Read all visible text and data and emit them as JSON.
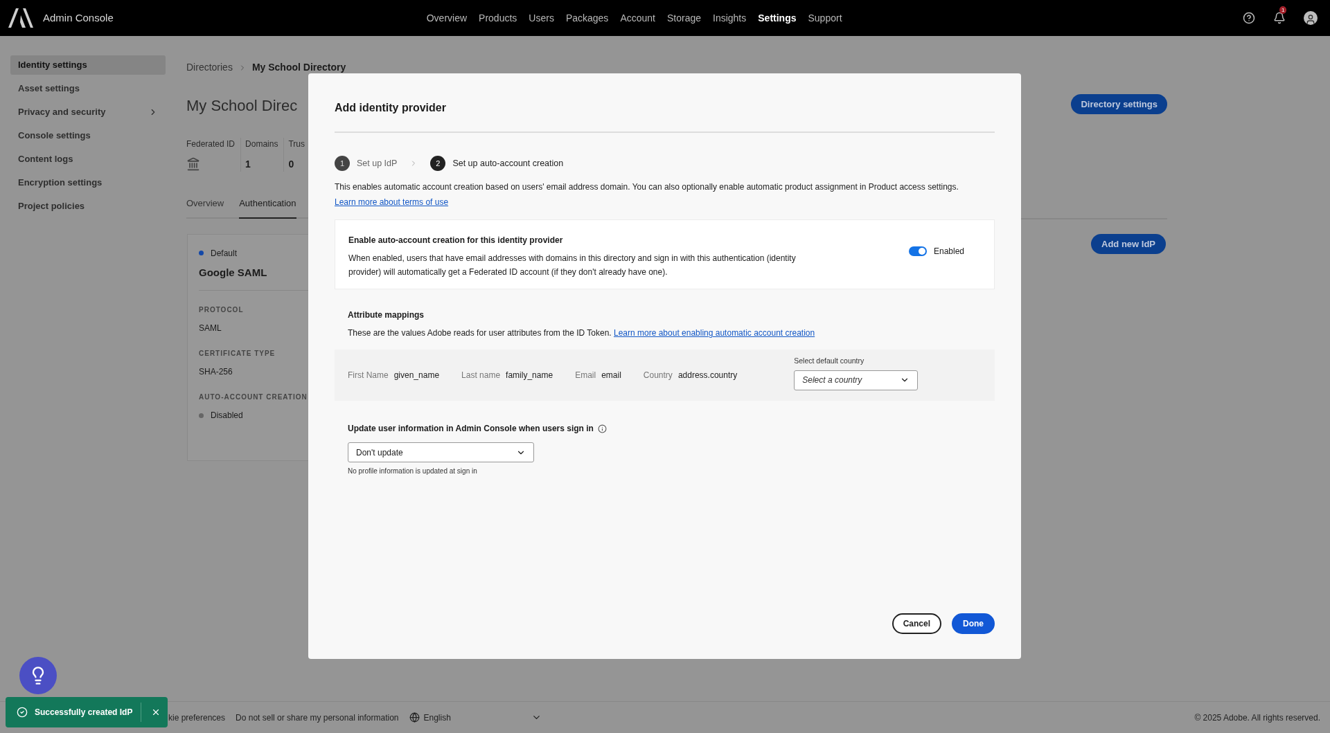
{
  "top_bar": {
    "app_name": "Admin Console",
    "notification_badge": "1",
    "nav": [
      {
        "label": "Overview",
        "selected": false
      },
      {
        "label": "Products",
        "selected": false
      },
      {
        "label": "Users",
        "selected": false
      },
      {
        "label": "Packages",
        "selected": false
      },
      {
        "label": "Account",
        "selected": false
      },
      {
        "label": "Storage",
        "selected": false
      },
      {
        "label": "Insights",
        "selected": false
      },
      {
        "label": "Settings",
        "selected": true
      },
      {
        "label": "Support",
        "selected": false
      }
    ]
  },
  "sidebar": {
    "items": [
      {
        "label": "Identity settings",
        "selected": true,
        "expandable": false
      },
      {
        "label": "Asset settings",
        "selected": false,
        "expandable": false
      },
      {
        "label": "Privacy and security",
        "selected": false,
        "expandable": true
      },
      {
        "label": "Console settings",
        "selected": false,
        "expandable": false
      },
      {
        "label": "Content logs",
        "selected": false,
        "expandable": false
      },
      {
        "label": "Encryption settings",
        "selected": false,
        "expandable": false
      },
      {
        "label": "Project policies",
        "selected": false,
        "expandable": false
      }
    ]
  },
  "breadcrumb": [
    "Directories",
    "My School Directory"
  ],
  "page_title": "My School Direc",
  "stats": [
    {
      "label": "Federated ID",
      "kind": "icon"
    },
    {
      "label": "Domains",
      "kind": "text",
      "value": "1"
    },
    {
      "label": "Trus",
      "kind": "text",
      "value": "0"
    }
  ],
  "tabs": [
    {
      "label": "Overview",
      "selected": false
    },
    {
      "label": "Authentication",
      "selected": true
    }
  ],
  "idp_card": {
    "default": true,
    "default_label": "Default",
    "name": "Google SAML",
    "fields": [
      {
        "label": "PROTOCOL",
        "value": "SAML",
        "kind": "text"
      },
      {
        "label": "CERTIFICATE TYPE",
        "value": "SHA-256",
        "kind": "text"
      },
      {
        "label": "AUTO-ACCOUNT CREATION",
        "value": "Disabled",
        "kind": "status",
        "enabled": false
      }
    ]
  },
  "page_buttons": [
    "Directory settings",
    "Add new IdP"
  ],
  "modal": {
    "title": "Add identity provider",
    "steps": [
      {
        "number": "1",
        "label": "Set up IdP",
        "selected": false
      },
      {
        "number": "2",
        "label": "Set up auto-account creation",
        "selected": true
      }
    ],
    "description": "This enables automatic account creation based on users' email address domain. You can also optionally enable automatic product assignment in Product access settings.",
    "description_link": "Learn more about terms of use",
    "auto_account": {
      "title": "Enable auto-account creation for this identity provider",
      "description": "When enabled, users that have email addresses with domains in this directory and sign in with this authentication (identity provider) will automatically get a Federated ID account (if they don't already have one).",
      "toggle": {
        "on": true,
        "label": "Enabled"
      }
    },
    "attribute_mappings": {
      "title": "Attribute mappings",
      "description": "These are the values Adobe reads for user attributes from the ID Token.",
      "link": "Learn more about enabling automatic account creation",
      "mappings": [
        {
          "label": "First Name",
          "value": "given_name"
        },
        {
          "label": "Last name",
          "value": "family_name"
        },
        {
          "label": "Email",
          "value": "email"
        },
        {
          "label": "Country",
          "value": "address.country"
        }
      ],
      "country_select": {
        "label": "Select default country",
        "placeholder": "Select a country"
      }
    },
    "update": {
      "title": "Update user information in Admin Console when users sign in",
      "value": "Don't update",
      "helper": "No profile information is updated at sign in"
    },
    "buttons": [
      {
        "label": "Cancel",
        "kind": "secondary"
      },
      {
        "label": "Done",
        "kind": "primary"
      }
    ]
  },
  "footer": {
    "links": [
      "kie preferences",
      "Do not sell or share my personal information"
    ],
    "language": "English",
    "copyright": "© 2025 Adobe. All rights reserved."
  },
  "toast": {
    "message": "Successfully created IdP"
  }
}
